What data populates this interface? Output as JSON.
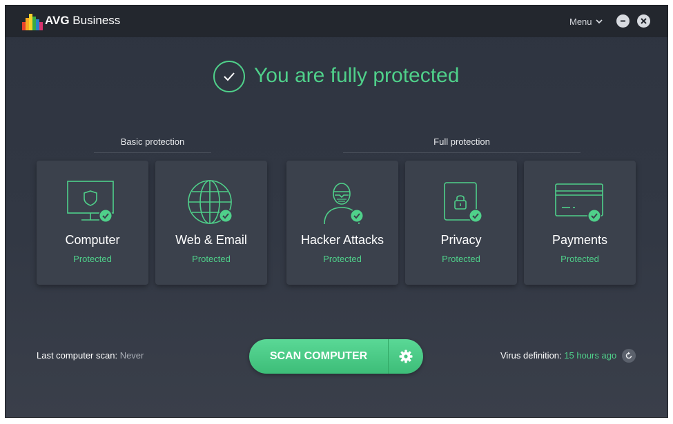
{
  "app": {
    "brand_bold": "AVG",
    "brand_rest": " Business",
    "menu_label": "Menu"
  },
  "window_controls": {
    "minimize_icon": "minimize-icon",
    "close_icon": "close-icon"
  },
  "hero": {
    "title": "You are fully protected",
    "icon": "check-circle-icon"
  },
  "groups": {
    "basic": "Basic protection",
    "full": "Full protection"
  },
  "tiles": [
    {
      "name": "Computer",
      "status": "Protected",
      "icon": "monitor-shield-icon"
    },
    {
      "name": "Web & Email",
      "status": "Protected",
      "icon": "globe-icon"
    },
    {
      "name": "Hacker Attacks",
      "status": "Protected",
      "icon": "hacker-icon"
    },
    {
      "name": "Privacy",
      "status": "Protected",
      "icon": "lock-icon"
    },
    {
      "name": "Payments",
      "status": "Protected",
      "icon": "credit-card-icon"
    }
  ],
  "footer": {
    "last_scan_label": "Last computer scan:",
    "last_scan_value": "Never",
    "scan_button": "SCAN COMPUTER",
    "virus_def_label": "Virus definition:",
    "virus_def_value": "15 hours ago"
  },
  "colors": {
    "accent": "#4fd08a",
    "background": "#2e3440",
    "tile": "#3b414c",
    "titlebar": "#23272e"
  }
}
